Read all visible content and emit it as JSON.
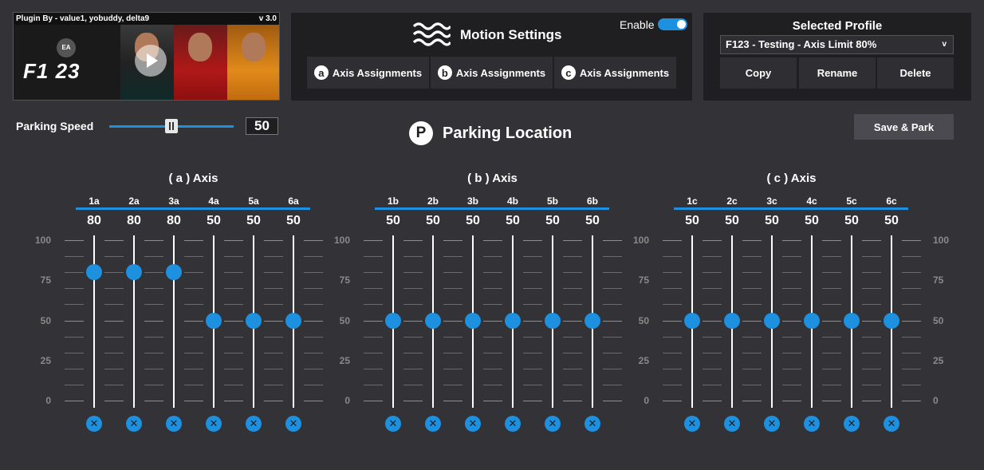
{
  "banner": {
    "credit": "Plugin By - value1, yobuddy, delta9",
    "version": "v 3.0",
    "ea_text": "EA",
    "game_logo": "F1 23"
  },
  "motion": {
    "title": "Motion Settings",
    "enable_label": "Enable",
    "enabled": true,
    "buttons": [
      {
        "icon": "a",
        "label": "Axis Assignments"
      },
      {
        "icon": "b",
        "label": "Axis Assignments"
      },
      {
        "icon": "c",
        "label": "Axis Assignments"
      }
    ]
  },
  "profile": {
    "title": "Selected Profile",
    "selected": "F123 - Testing - Axis Limit 80%",
    "chevron": "v",
    "copy_label": "Copy",
    "rename_label": "Rename",
    "delete_label": "Delete"
  },
  "parking": {
    "speed_label": "Parking Speed",
    "speed_value": "50",
    "speed_fraction": 0.5,
    "location_title": "Parking Location",
    "location_icon": "P",
    "save_label": "Save & Park"
  },
  "scale": [
    "100",
    "75",
    "50",
    "25",
    "0"
  ],
  "reset_glyph": "✕",
  "colors": {
    "accent": "#1e90e0",
    "panel": "#1f1f22",
    "background": "#323237"
  },
  "groups": [
    {
      "title": "( a ) Axis",
      "channels": [
        {
          "label": "1a",
          "value": 80
        },
        {
          "label": "2a",
          "value": 80
        },
        {
          "label": "3a",
          "value": 80
        },
        {
          "label": "4a",
          "value": 50
        },
        {
          "label": "5a",
          "value": 50
        },
        {
          "label": "6a",
          "value": 50
        }
      ]
    },
    {
      "title": "( b ) Axis",
      "channels": [
        {
          "label": "1b",
          "value": 50
        },
        {
          "label": "2b",
          "value": 50
        },
        {
          "label": "3b",
          "value": 50
        },
        {
          "label": "4b",
          "value": 50
        },
        {
          "label": "5b",
          "value": 50
        },
        {
          "label": "6b",
          "value": 50
        }
      ]
    },
    {
      "title": "( c ) Axis",
      "channels": [
        {
          "label": "1c",
          "value": 50
        },
        {
          "label": "2c",
          "value": 50
        },
        {
          "label": "3c",
          "value": 50
        },
        {
          "label": "4c",
          "value": 50
        },
        {
          "label": "5c",
          "value": 50
        },
        {
          "label": "6c",
          "value": 50
        }
      ]
    }
  ]
}
